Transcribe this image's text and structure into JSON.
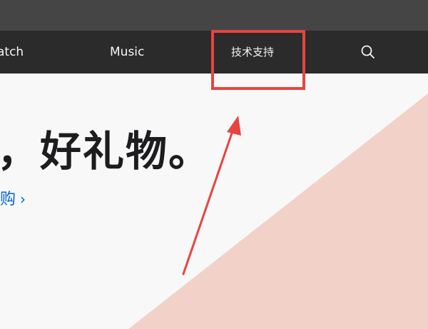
{
  "nav": {
    "items": [
      "atch",
      "Music",
      "技术支持"
    ],
    "search_icon": "search-icon"
  },
  "hero": {
    "headline": "，好礼物。",
    "link_text": "购",
    "link_chevron": "›"
  },
  "annotation": {
    "highlight_color": "#e8443f",
    "triangle_color": "#f2d2c8"
  }
}
